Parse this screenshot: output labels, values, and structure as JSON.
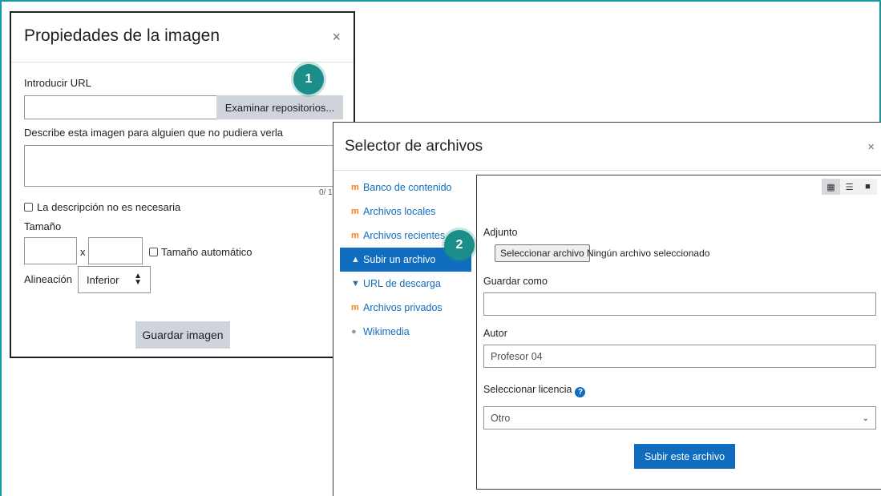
{
  "image_dialog": {
    "title": "Propiedades de la imagen",
    "close": "×",
    "url_label": "Introducir URL",
    "url_value": "",
    "browse_button": "Examinar repositorios...",
    "desc_label": "Describe esta imagen para alguien que no pudiera verla",
    "desc_value": "",
    "desc_counter": "0/ 1",
    "desc_not_needed": "La descripción no es necesaria",
    "size_label": "Tamaño",
    "size_x": "x",
    "auto_size": "Tamaño automático",
    "align_label": "Alineación",
    "align_value": "Inferior",
    "save_button": "Guardar imagen"
  },
  "badges": {
    "one": "1",
    "two": "2"
  },
  "file_picker": {
    "title": "Selector de archivos",
    "close": "×",
    "repositories": [
      {
        "label": "Banco de contenido",
        "icon": "moodle-icon",
        "active": false
      },
      {
        "label": "Archivos locales",
        "icon": "moodle-icon",
        "active": false
      },
      {
        "label": "Archivos recientes",
        "icon": "moodle-icon",
        "active": false
      },
      {
        "label": "Subir un archivo",
        "icon": "upload-icon",
        "active": true
      },
      {
        "label": "URL de descarga",
        "icon": "download-icon",
        "active": false
      },
      {
        "label": "Archivos privados",
        "icon": "moodle-icon",
        "active": false
      },
      {
        "label": "Wikimedia",
        "icon": "wikimedia-icon",
        "active": false
      }
    ],
    "attachment_label": "Adjunto",
    "choose_file_button": "Seleccionar archivo",
    "no_file_text": "Ningún archivo seleccionado",
    "save_as_label": "Guardar como",
    "save_as_value": "",
    "author_label": "Autor",
    "author_value": "Profesor 04",
    "license_label": "Seleccionar licencia",
    "license_value": "Otro",
    "upload_button": "Subir este archivo"
  },
  "colors": {
    "primary": "#0f6cbf",
    "badge": "#1b8e8a",
    "frame": "#1a9aa0",
    "gray_button": "#ced4da"
  }
}
